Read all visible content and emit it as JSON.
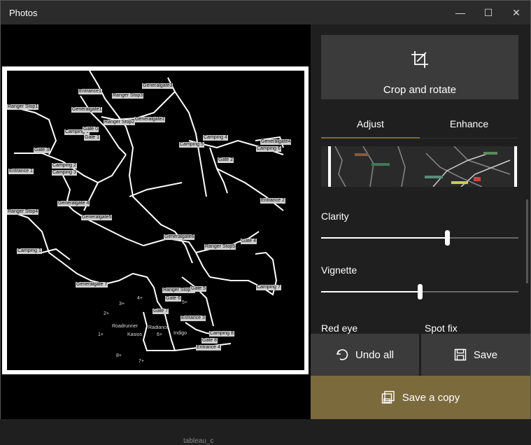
{
  "window": {
    "title": "Photos"
  },
  "controls": {
    "minimize": "—",
    "maximize": "☐",
    "close": "✕"
  },
  "panel": {
    "crop_label": "Crop and rotate",
    "tabs": [
      {
        "label": "Adjust",
        "active": true
      },
      {
        "label": "Enhance",
        "active": false
      }
    ],
    "sliders": [
      {
        "label": "Clarity",
        "value": 0.64
      },
      {
        "label": "Vignette",
        "value": 0.5
      }
    ],
    "tools": [
      "Red eye",
      "Spot fix"
    ],
    "undo_label": "Undo all",
    "save_label": "Save",
    "save_copy_label": "Save a copy"
  },
  "map": {
    "labels": [
      "Entrance1",
      "Ranger Stop3",
      "Generalgate3",
      "Ranger Stop1",
      "Generalgate1",
      "Generalgate2",
      "Ranger Stop2",
      "Camping 0",
      "Gate 0",
      "Gate 1",
      "Camping 4",
      "Camping 5",
      "Generalgate4",
      "Gate 3",
      "Camping 2",
      "Camping 3",
      "Entrance 1",
      "Camping 6",
      "Gate 2",
      "Entrance 2",
      "Ranger Stop4",
      "Generalgate 4",
      "Generalgate5",
      "Ranger Stop5",
      "Gate 4",
      "Camping 1",
      "Generalgate6",
      "Generalgate 7",
      "Camping 7",
      "Ranger Stop 6",
      "Gate 5",
      "Gate 6",
      "Gate 7",
      "Entrance 3",
      "Camping 8",
      "Gate 8",
      "Entrance 4"
    ],
    "texts": [
      "Roadrunner",
      "Kasios",
      "Radiance",
      "Indigo",
      "1+",
      "2+",
      "3+",
      "4+",
      "5+",
      "6+",
      "7+",
      "8+"
    ]
  },
  "taskbar": {
    "hint": "tableau_c"
  }
}
